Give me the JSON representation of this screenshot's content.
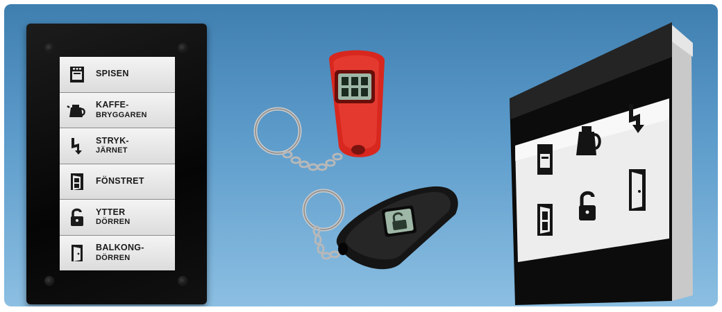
{
  "wall_panel": {
    "labels": [
      {
        "icon": "stove-icon",
        "line1": "SPISEN",
        "line2": ""
      },
      {
        "icon": "coffee-maker-icon",
        "line1": "KAFFE-",
        "line2": "BRYGGAREN"
      },
      {
        "icon": "iron-lightning-icon",
        "line1": "STRYK-",
        "line2": "JÄRNET"
      },
      {
        "icon": "window-icon",
        "line1": "FÖNSTRET",
        "line2": ""
      },
      {
        "icon": "unlocked-padlock-icon",
        "line1": "YTTER",
        "line2": "DÖRREN"
      },
      {
        "icon": "door-icon",
        "line1": "BALKONG-",
        "line2": "DÖRREN"
      }
    ]
  },
  "colors": {
    "background_top": "#3f7fb0",
    "background_bottom": "#8cbfe2",
    "red_fob": "#d8271e",
    "black_fob": "#151515",
    "fob_display": "#9fb7a6"
  }
}
